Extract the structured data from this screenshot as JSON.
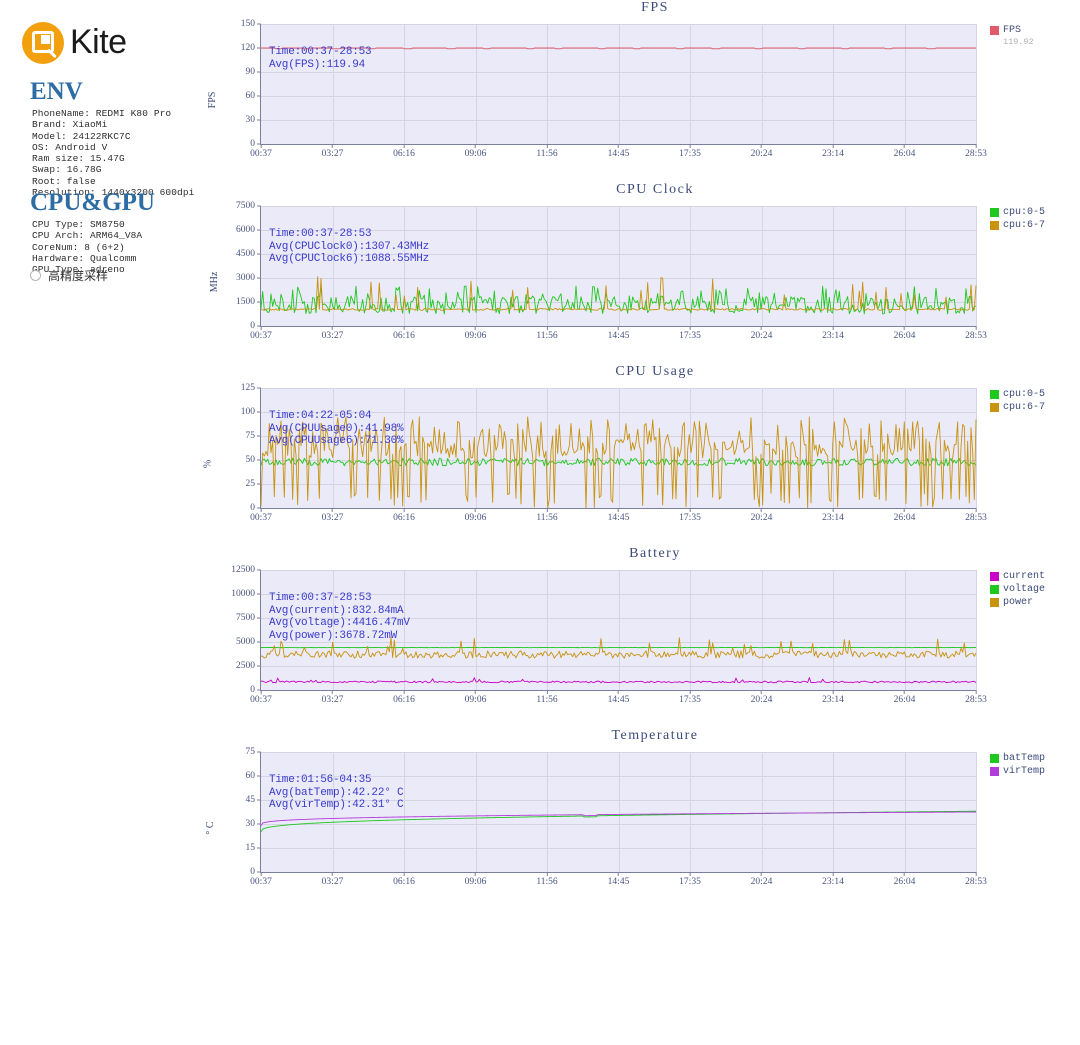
{
  "app": {
    "name": "Kite",
    "logo_icon": "kite-magnifier-icon",
    "logo_color": "#F3A00E"
  },
  "sidebar": {
    "env": {
      "title": "ENV",
      "rows": [
        "PhoneName: REDMI K80 Pro",
        "Brand: XiaoMi",
        "Model: 24122RKC7C",
        "OS: Android V",
        "Ram size: 15.47G",
        "Swap: 16.78G",
        "Root: false",
        "Resolution: 1440x3200 600dpi"
      ]
    },
    "cpu_gpu": {
      "title": "CPU&GPU",
      "rows": [
        "CPU Type: SM8750",
        "CPU Arch: ARM64_V8A",
        "CoreNum: 8 (6+2)",
        "Hardware: Qualcomm",
        "GPU Type: adreno"
      ]
    },
    "sampling_toggle": {
      "label": "高精度采样",
      "checked": false,
      "icon": "radio-unchecked-icon"
    }
  },
  "shared": {
    "x_ticks": [
      "00:37",
      "03:27",
      "06:16",
      "09:06",
      "11:56",
      "14:45",
      "17:35",
      "20:24",
      "23:14",
      "26:04",
      "28:53"
    ]
  },
  "colors": {
    "fps": "#e05b6a",
    "green": "#1ec81e",
    "orange": "#c8930f",
    "magenta": "#c800c8",
    "purple": "#b23cd8",
    "plot_bg": "#eaeaf8",
    "grid": "#d4d4e4",
    "annotation": "#3b3bcd",
    "title": "#3c4b7a"
  },
  "chart_data": [
    {
      "type": "line",
      "title": "FPS",
      "ylabel": "FPS",
      "xlabel": "",
      "ylim": [
        0,
        150
      ],
      "y_ticks": [
        0,
        30,
        60,
        90,
        120,
        150
      ],
      "x_ticks": [
        "00:37",
        "03:27",
        "06:16",
        "09:06",
        "11:56",
        "14:45",
        "17:35",
        "20:24",
        "23:14",
        "26:04",
        "28:53"
      ],
      "grid": true,
      "legend_position": "right",
      "legend": [
        {
          "name": "FPS",
          "color": "#e05b6a",
          "value": "119.92"
        }
      ],
      "annotations": [
        "Time:00:37-28:53",
        "Avg(FPS):119.94"
      ],
      "series": [
        {
          "name": "FPS",
          "color": "#e05b6a",
          "mean": 119.94,
          "values": [
            120,
            120,
            119,
            120,
            120,
            120,
            119,
            120,
            120,
            120,
            119,
            120,
            120,
            120,
            120,
            119,
            120,
            120,
            120,
            120,
            119,
            120,
            120,
            120,
            120,
            120,
            119,
            120,
            120,
            120,
            120,
            119,
            120,
            120,
            120,
            120,
            120,
            119,
            120,
            120,
            120,
            119,
            120,
            120,
            120,
            120,
            120,
            119,
            120,
            120,
            120,
            120,
            119,
            120,
            120,
            120,
            120,
            120,
            119,
            120,
            120,
            120,
            120,
            119,
            120,
            120,
            120,
            120,
            120,
            119,
            120,
            120,
            120,
            120,
            120,
            119,
            120,
            120,
            120,
            120,
            120,
            119,
            120,
            120,
            120,
            120,
            120,
            119,
            120,
            120,
            120,
            120,
            120,
            119,
            120,
            120,
            120,
            120,
            120,
            120
          ]
        }
      ]
    },
    {
      "type": "line",
      "title": "CPU Clock",
      "ylabel": "MHz",
      "xlabel": "",
      "ylim": [
        0,
        7500
      ],
      "y_ticks": [
        0,
        1500,
        3000,
        4500,
        6000,
        7500
      ],
      "x_ticks": [
        "00:37",
        "03:27",
        "06:16",
        "09:06",
        "11:56",
        "14:45",
        "17:35",
        "20:24",
        "23:14",
        "26:04",
        "28:53"
      ],
      "grid": true,
      "legend_position": "right",
      "legend": [
        {
          "name": "cpu:0-5",
          "color": "#1ec81e"
        },
        {
          "name": "cpu:6-7",
          "color": "#c8930f"
        }
      ],
      "annotations": [
        "Time:00:37-28:53",
        "Avg(CPUClock0):1307.43MHz",
        "Avg(CPUClock6):1088.55MHz"
      ],
      "series": [
        {
          "name": "cpu:0-5",
          "color": "#1ec81e",
          "mean": 1307.43,
          "baseline": 1300,
          "noise": 550,
          "spike_rate": 0.18,
          "spike_max": 2500
        },
        {
          "name": "cpu:6-7",
          "color": "#c8930f",
          "mean": 1088.55,
          "baseline": 1040,
          "noise": 60,
          "spike_rate": 0.07,
          "spike_max": 3200
        }
      ]
    },
    {
      "type": "line",
      "title": "CPU Usage",
      "ylabel": "%",
      "xlabel": "",
      "ylim": [
        0,
        125
      ],
      "y_ticks": [
        0,
        25,
        50,
        75,
        100,
        125
      ],
      "x_ticks": [
        "00:37",
        "03:27",
        "06:16",
        "09:06",
        "11:56",
        "14:45",
        "17:35",
        "20:24",
        "23:14",
        "26:04",
        "28:53"
      ],
      "grid": true,
      "legend_position": "right",
      "legend": [
        {
          "name": "cpu:0-5",
          "color": "#1ec81e"
        },
        {
          "name": "cpu:6-7",
          "color": "#c8930f"
        }
      ],
      "annotations": [
        "Time:04:22-05:04",
        "Avg(CPUUsage0):41.98%",
        "Avg(CPUUsage6):71.30%"
      ],
      "series": [
        {
          "name": "cpu:0-5",
          "color": "#1ec81e",
          "mean": 41.98,
          "baseline": 48,
          "noise": 4,
          "spike_rate": 0.0,
          "spike_max": 55
        },
        {
          "name": "cpu:6-7",
          "color": "#c8930f",
          "mean": 71.3,
          "baseline": 62,
          "noise": 10,
          "spike_rate": 0.45,
          "spike_max": 95,
          "drop_min": 0
        }
      ]
    },
    {
      "type": "line",
      "title": "Battery",
      "ylabel": "",
      "xlabel": "",
      "ylim": [
        0,
        12500
      ],
      "y_ticks": [
        0,
        2500,
        5000,
        7500,
        10000,
        12500
      ],
      "x_ticks": [
        "00:37",
        "03:27",
        "06:16",
        "09:06",
        "11:56",
        "14:45",
        "17:35",
        "20:24",
        "23:14",
        "26:04",
        "28:53"
      ],
      "grid": true,
      "legend_position": "right",
      "legend": [
        {
          "name": "current",
          "color": "#c800c8"
        },
        {
          "name": "voltage",
          "color": "#1ec81e"
        },
        {
          "name": "power",
          "color": "#c8930f"
        }
      ],
      "annotations": [
        "Time:00:37-28:53",
        "Avg(current):832.84mA",
        "Avg(voltage):4416.47mV",
        "Avg(power):3678.72mW"
      ],
      "series": [
        {
          "name": "current",
          "color": "#c800c8",
          "mean": 832.84,
          "baseline": 840,
          "noise": 90,
          "spike_rate": 0.03,
          "spike_max": 1300
        },
        {
          "name": "voltage",
          "color": "#1ec81e",
          "mean": 4416.47,
          "baseline": 4420,
          "noise": 10,
          "spike_rate": 0.0,
          "spike_max": 4440
        },
        {
          "name": "power",
          "color": "#c8930f",
          "mean": 3678.72,
          "baseline": 3700,
          "noise": 380,
          "spike_rate": 0.05,
          "spike_max": 5500
        }
      ]
    },
    {
      "type": "line",
      "title": "Temperature",
      "ylabel": "° C",
      "xlabel": "",
      "ylim": [
        0,
        75
      ],
      "y_ticks": [
        0,
        15,
        30,
        45,
        60,
        75
      ],
      "x_ticks": [
        "00:37",
        "03:27",
        "06:16",
        "09:06",
        "11:56",
        "14:45",
        "17:35",
        "20:24",
        "23:14",
        "26:04",
        "28:53"
      ],
      "grid": true,
      "legend_position": "right",
      "legend": [
        {
          "name": "batTemp",
          "color": "#1ec81e"
        },
        {
          "name": "virTemp",
          "color": "#b23cd8"
        }
      ],
      "annotations": [
        "Time:01:56-04:35",
        "Avg(batTemp):42.22° C",
        "Avg(virTemp):42.31° C"
      ],
      "series": [
        {
          "name": "batTemp",
          "color": "#1ec81e",
          "mean": 42.22,
          "curve": "rise",
          "start": 25,
          "end": 38
        },
        {
          "name": "virTemp",
          "color": "#b23cd8",
          "mean": 42.31,
          "curve": "rise2",
          "start": 29,
          "end": 37.5
        }
      ]
    }
  ]
}
